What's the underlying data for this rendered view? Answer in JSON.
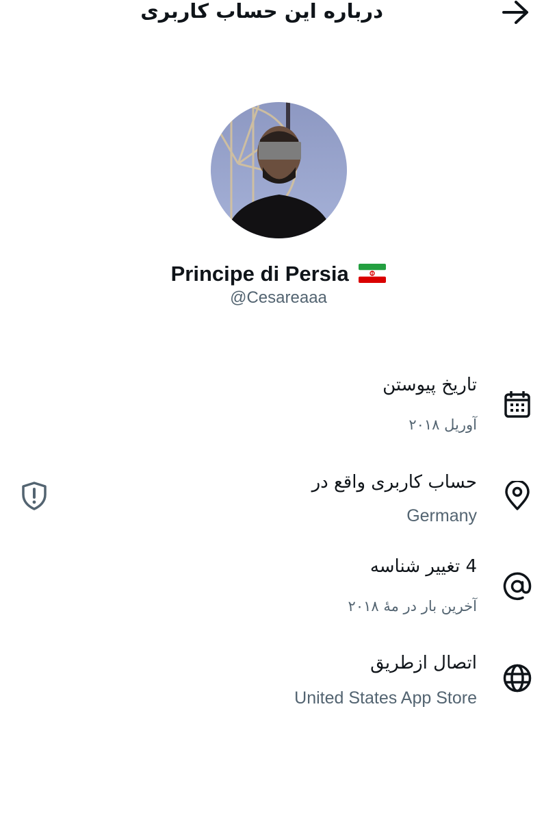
{
  "header": {
    "title": "درباره این حساب کاربری",
    "back_icon": "arrow-right-icon"
  },
  "profile": {
    "display_name": "Principe di Persia",
    "flag": "iran-flag-emoji",
    "handle": "@Cesareaaa"
  },
  "rows": [
    {
      "icon": "calendar-icon",
      "title": "تاریخ پیوستن",
      "subtitle": "آوریل ۲۰۱۸"
    },
    {
      "icon": "location-pin-icon",
      "title": "حساب کاربری واقع در",
      "subtitle": "Germany",
      "action_icon": "shield-alert-icon"
    },
    {
      "icon": "at-sign-icon",
      "title": "4 تغییر شناسه",
      "subtitle": "آخرین بار در مهٔ ۲۰۱۸"
    },
    {
      "icon": "globe-icon",
      "title": "اتصال ازطریق",
      "subtitle": "United States App Store"
    }
  ],
  "colors": {
    "text_primary": "#0f1419",
    "text_secondary": "#536471",
    "background": "#ffffff"
  }
}
